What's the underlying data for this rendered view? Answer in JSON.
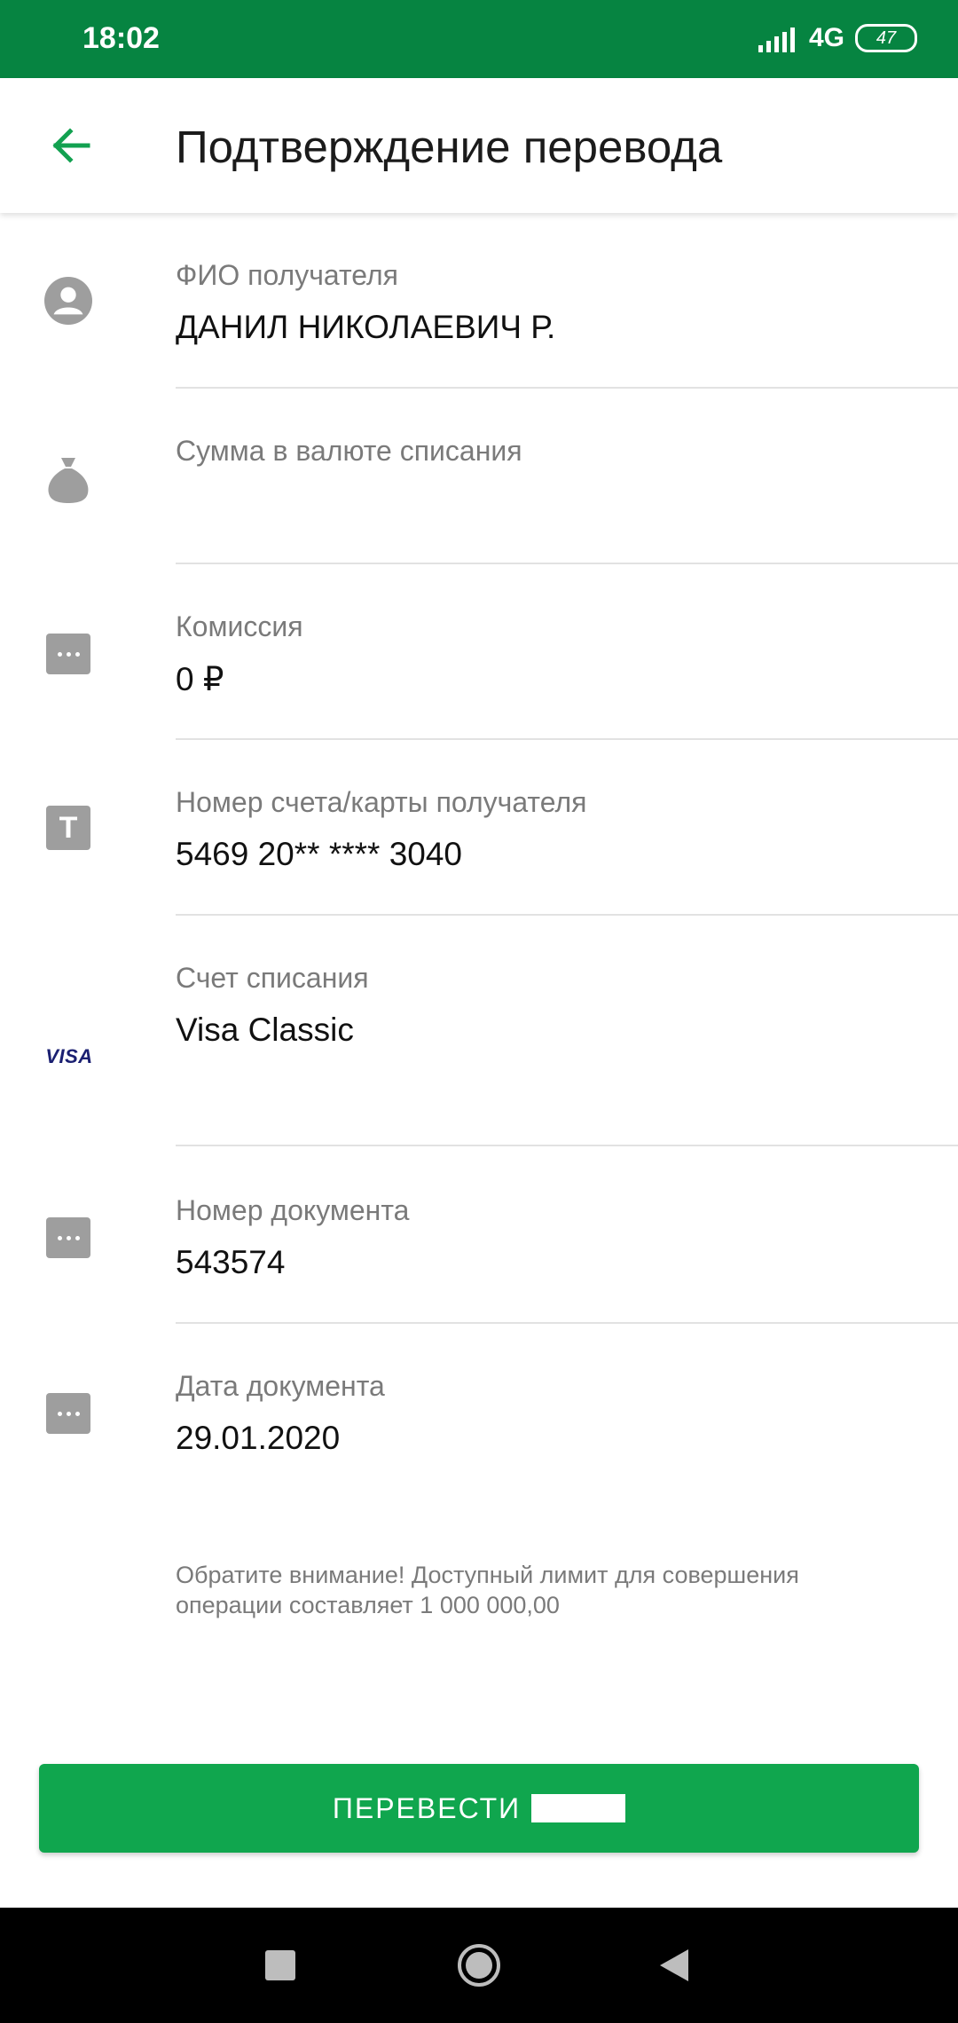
{
  "status_bar": {
    "time": "18:02",
    "network": "4G",
    "battery": "47"
  },
  "app_bar": {
    "title": "Подтверждение перевода"
  },
  "fields": [
    {
      "label": "ФИО получателя",
      "value": "ДАНИЛ НИКОЛАЕВИЧ Р.",
      "icon": "person-icon"
    },
    {
      "label": "Сумма в валюте списания",
      "value": "",
      "icon": "money-bag-icon"
    },
    {
      "label": "Комиссия",
      "value": "0 ₽",
      "icon": "more-icon"
    },
    {
      "label": "Номер счета/карты получателя",
      "value": "5469 20** **** 3040",
      "icon": "card-t-icon"
    },
    {
      "label": "Счет списания",
      "value": "Visa Classic",
      "icon": "visa-icon",
      "icon_text": "VISA"
    },
    {
      "label": "Номер документа",
      "value": "543574",
      "icon": "more-icon"
    },
    {
      "label": "Дата документа",
      "value": "29.01.2020",
      "icon": "more-icon"
    }
  ],
  "notice": "Обратите внимание! Доступный лимит для совершения операции составляет 1 000 000,00",
  "transfer_button": {
    "label": "ПЕРЕВЕСТИ"
  },
  "colors": {
    "status_bar": "#068441",
    "accent": "#10a64e",
    "back_arrow": "#12a150"
  }
}
